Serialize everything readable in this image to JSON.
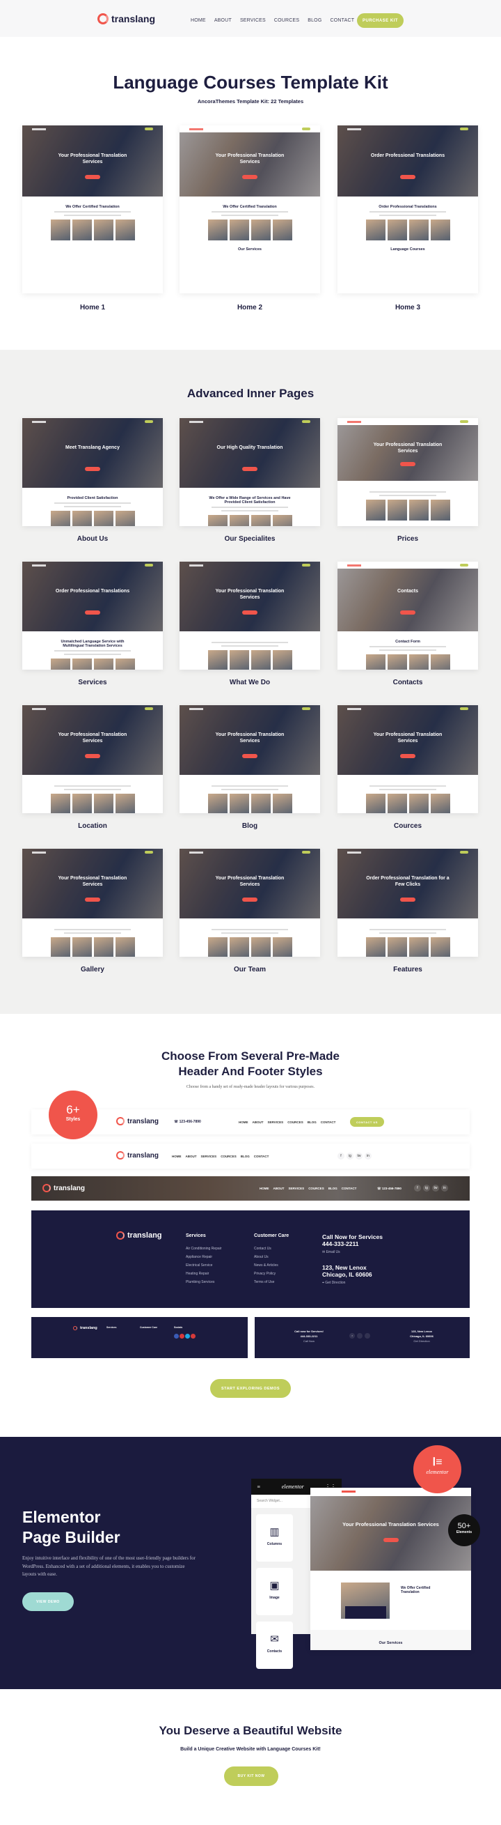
{
  "colors": {
    "navy": "#1b1b3e",
    "accent_green": "#bfcd5a",
    "accent_red": "#f0554b",
    "accent_teal": "#9fdad3"
  },
  "header": {
    "logo": "translang",
    "nav": [
      "HOME",
      "ABOUT",
      "SERVICES",
      "COURCES",
      "BLOG",
      "CONTACT"
    ],
    "cta": "PURCHASE KIT"
  },
  "intro": {
    "title": "Language Courses Template Kit",
    "subtitle": "AncoraThemes Template Kit: 22 Templates"
  },
  "homes": [
    {
      "label": "Home 1",
      "hero_title": "Your Professional Translation Services",
      "section": "We Offer Certified Translation",
      "style": "dark"
    },
    {
      "label": "Home 2",
      "hero_title": "Your Professional Translation Services",
      "section": "We Offer Certified Translation",
      "footer": "Our Services",
      "style": "light"
    },
    {
      "label": "Home 3",
      "hero_title": "Order Professional Translations",
      "section": "Order Professional Translations",
      "footer": "Language Courses",
      "style": "dark"
    }
  ],
  "inner": {
    "title": "Advanced Inner Pages",
    "pages": [
      {
        "label": "About Us",
        "hero_title": "Meet Translang Agency",
        "section": "Provided Client Satisfaction"
      },
      {
        "label": "Our Specialites",
        "hero_title": "Our High Quality Translation",
        "section": "We Offer a Wide Range of Services and Have Provided Client Satisfaction"
      },
      {
        "label": "Prices",
        "hero_title": "Your Professional Translation Services",
        "section": ""
      },
      {
        "label": "Services",
        "hero_title": "Order Professional Translations",
        "section": "Unmatched Language Service with Multilingual Translation Services"
      },
      {
        "label": "What We Do",
        "hero_title": "Your Professional Translation Services",
        "section": ""
      },
      {
        "label": "Contacts",
        "hero_title": "Contacts",
        "section": "Contact Form"
      },
      {
        "label": "Location",
        "hero_title": "Your Professional Translation Services",
        "section": ""
      },
      {
        "label": "Blog",
        "hero_title": "Your Professional Translation Services",
        "section": ""
      },
      {
        "label": "Cources",
        "hero_title": "Your Professional Translation Services",
        "section": ""
      },
      {
        "label": "Gallery",
        "hero_title": "Your Professional Translation Services",
        "section": ""
      },
      {
        "label": "Our Team",
        "hero_title": "Your Professional Translation Services",
        "section": ""
      },
      {
        "label": "Features",
        "hero_title": "Order Professional Translation for a Few Clicks",
        "section": ""
      }
    ]
  },
  "styles": {
    "title_line1": "Choose From Several Pre-Made",
    "title_line2": "Header And Footer Styles",
    "subtitle": "Choose from a handy set of ready-made header layouts for various purposes.",
    "badge_number": "6+",
    "badge_label": "Styles",
    "phone": "123-456-7890",
    "contact_button": "CONTACT US",
    "social": [
      "f",
      "ig",
      "tw",
      "in"
    ],
    "footer": {
      "services_title": "Services",
      "services": [
        "Air Conditioning Repair",
        "Appliance Repair",
        "Electrical Service",
        "Heating Repair",
        "Plumbing Services"
      ],
      "care_title": "Customer Care",
      "care": [
        "Contact Us",
        "About Us",
        "News & Articles",
        "Privacy Policy",
        "Terms of Use"
      ],
      "call_title": "Call Now for Services",
      "call_number": "444-333-2211",
      "email": "Email Us",
      "address_line1": "123, New Lenox",
      "address_line2": "Chicago, IL 60606",
      "direction": "Get Direction",
      "socials_title": "Socials",
      "call_small": "Call now for Services!",
      "call_now": "Call Now"
    },
    "cta": "START EXPLORING DEMOS"
  },
  "elementor": {
    "title_line1": "Elementor",
    "title_line2": "Page Builder",
    "text": "Enjoy intuitive interface and flexibility of one of the most user-friendly page builders for WordPress. Enhanced with a set of additional elements, it enables you to customize layouts with ease.",
    "button": "VIEW DEMO",
    "panel_logo": "elementor",
    "search_placeholder": "Search Widget...",
    "widgets": [
      "Columns",
      "Image",
      "Contacts"
    ],
    "preview_hero": "Your Professional Translation Services",
    "preview_section": "We Offer Certified Translation",
    "preview_footer": "Our Services",
    "badge_logo": "elementor",
    "elements_number": "50+",
    "elements_label": "Elements"
  },
  "final": {
    "title": "You Deserve a Beautiful Website",
    "subtitle": "Build a Unique Creative Website with Language Courses Kit!",
    "button": "BUY KIT NOW"
  }
}
